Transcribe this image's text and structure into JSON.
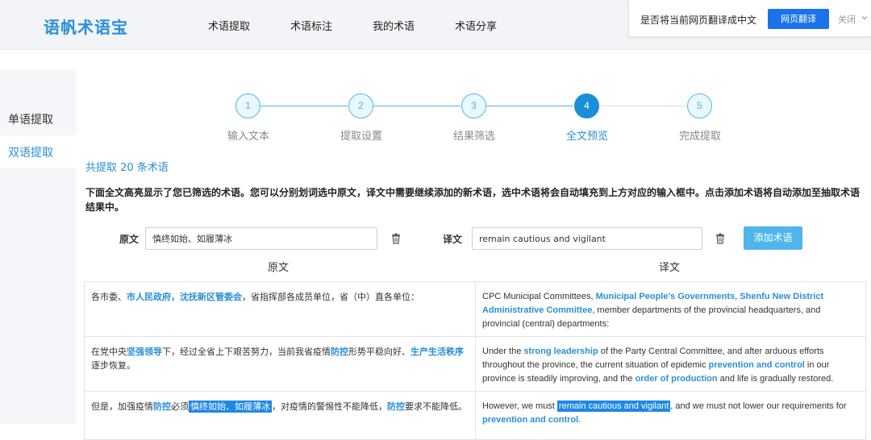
{
  "header": {
    "logo": "语帆术语宝",
    "nav": [
      "术语提取",
      "术语标注",
      "我的术语",
      "术语分享"
    ]
  },
  "translate_bar": {
    "prompt": "是否将当前网页翻译成中文",
    "button": "网页翻译",
    "close": "关闭"
  },
  "sidebar": {
    "items": [
      {
        "label": "单语提取",
        "active": false
      },
      {
        "label": "双语提取",
        "active": true
      }
    ]
  },
  "stepper": {
    "steps": [
      {
        "num": "1",
        "label": "输入文本",
        "active": false
      },
      {
        "num": "2",
        "label": "提取设置",
        "active": false
      },
      {
        "num": "3",
        "label": "结果筛选",
        "active": false
      },
      {
        "num": "4",
        "label": "全文预览",
        "active": true
      },
      {
        "num": "5",
        "label": "完成提取",
        "active": false
      }
    ]
  },
  "summary": "共提取 20 条术语",
  "instruction": "下面全文高亮显示了您已筛选的术语。您可以分别划词选中原文，译文中需要继续添加的新术语，选中术语将会自动填充到上方对应的输入框中。点击添加术语将自动添加至抽取术语结果中。",
  "form": {
    "source_label": "原文",
    "source_value": "慎终如始、如履薄冰",
    "target_label": "译文",
    "target_value": "remain cautious and vigilant",
    "add_button": "添加术语"
  },
  "table": {
    "headers": [
      "原文",
      "译文"
    ],
    "rows": [
      {
        "src": [
          {
            "t": "各市委、"
          },
          {
            "t": "市人民政府，沈抚新区管委会",
            "k": "term"
          },
          {
            "t": "，省指挥部各成员单位，省（中）直各单位："
          }
        ],
        "tgt": [
          {
            "t": "CPC Municipal Committees, "
          },
          {
            "t": "Municipal People's Governments",
            "k": "term"
          },
          {
            "t": ", "
          },
          {
            "t": "Shenfu New District Administrative Committee",
            "k": "term"
          },
          {
            "t": ", member departments of the provincial headquarters, and provincial (central) departments:"
          }
        ]
      },
      {
        "src": [
          {
            "t": "在党中央"
          },
          {
            "t": "坚强领导",
            "k": "term"
          },
          {
            "t": "下，经过全省上下艰苦努力，当前我省疫情"
          },
          {
            "t": "防控",
            "k": "term"
          },
          {
            "t": "形势平稳向好、"
          },
          {
            "t": "生产生活秩序",
            "k": "term"
          },
          {
            "t": "逐步恢复。"
          }
        ],
        "tgt": [
          {
            "t": "Under the "
          },
          {
            "t": "strong leadership",
            "k": "term"
          },
          {
            "t": " of the Party Central Committee, and after arduous efforts throughout the province, the current situation of epidemic "
          },
          {
            "t": "prevention and control",
            "k": "term"
          },
          {
            "t": " in our province is steadily improving, and the "
          },
          {
            "t": "order of production",
            "k": "term"
          },
          {
            "t": " and life is gradually restored."
          }
        ]
      },
      {
        "src": [
          {
            "t": "但是，加强疫情"
          },
          {
            "t": "防控",
            "k": "term"
          },
          {
            "t": "必须"
          },
          {
            "t": "慎终如始、如履薄冰",
            "k": "sel"
          },
          {
            "t": "，对疫情的警惕性不能降低，"
          },
          {
            "t": "防控",
            "k": "term"
          },
          {
            "t": "要求不能降低。"
          }
        ],
        "tgt": [
          {
            "t": "However, we must "
          },
          {
            "t": "remain cautious and vigilant",
            "k": "sel"
          },
          {
            "t": ", and we must not lower our requirements for "
          },
          {
            "t": "prevention and control",
            "k": "term"
          },
          {
            "t": "."
          }
        ]
      }
    ]
  }
}
